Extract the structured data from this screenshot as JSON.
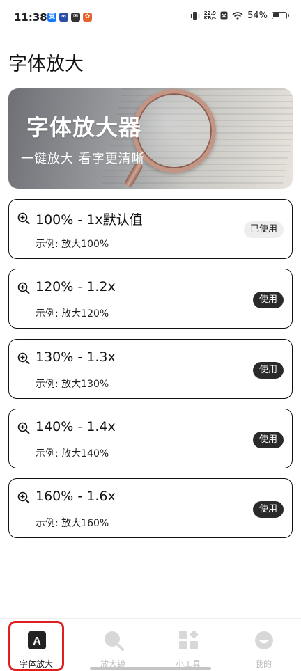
{
  "status_bar": {
    "time": "11:38",
    "net_speed_value": "22.9",
    "net_speed_unit": "KB/s",
    "battery": "54%"
  },
  "page": {
    "title": "字体放大"
  },
  "banner": {
    "title": "字体放大器",
    "subtitle": "一键放大 看字更清晰"
  },
  "options": [
    {
      "title": "100% - 1x默认值",
      "example": "示例: 放大100%",
      "button": "已使用",
      "active": true
    },
    {
      "title": "120% - 1.2x",
      "example": "示例: 放大120%",
      "button": "使用",
      "active": false
    },
    {
      "title": "130% - 1.3x",
      "example": "示例: 放大130%",
      "button": "使用",
      "active": false
    },
    {
      "title": "140% - 1.4x",
      "example": "示例: 放大140%",
      "button": "使用",
      "active": false
    },
    {
      "title": "160% - 1.6x",
      "example": "示例: 放大160%",
      "button": "使用",
      "active": false
    }
  ],
  "bottom_nav": [
    {
      "label": "字体放大",
      "icon": "font-a-icon",
      "active": true
    },
    {
      "label": "放大镜",
      "icon": "magnifier-icon",
      "active": false
    },
    {
      "label": "小工具",
      "icon": "widgets-icon",
      "active": false
    },
    {
      "label": "我的",
      "icon": "profile-icon",
      "active": false
    }
  ],
  "colors": {
    "card_border": "#111111",
    "use_button_bg": "#2a2a2a",
    "used_button_bg": "#eeeeee",
    "highlight": "#e02020",
    "nav_inactive": "#bcbcbc"
  }
}
